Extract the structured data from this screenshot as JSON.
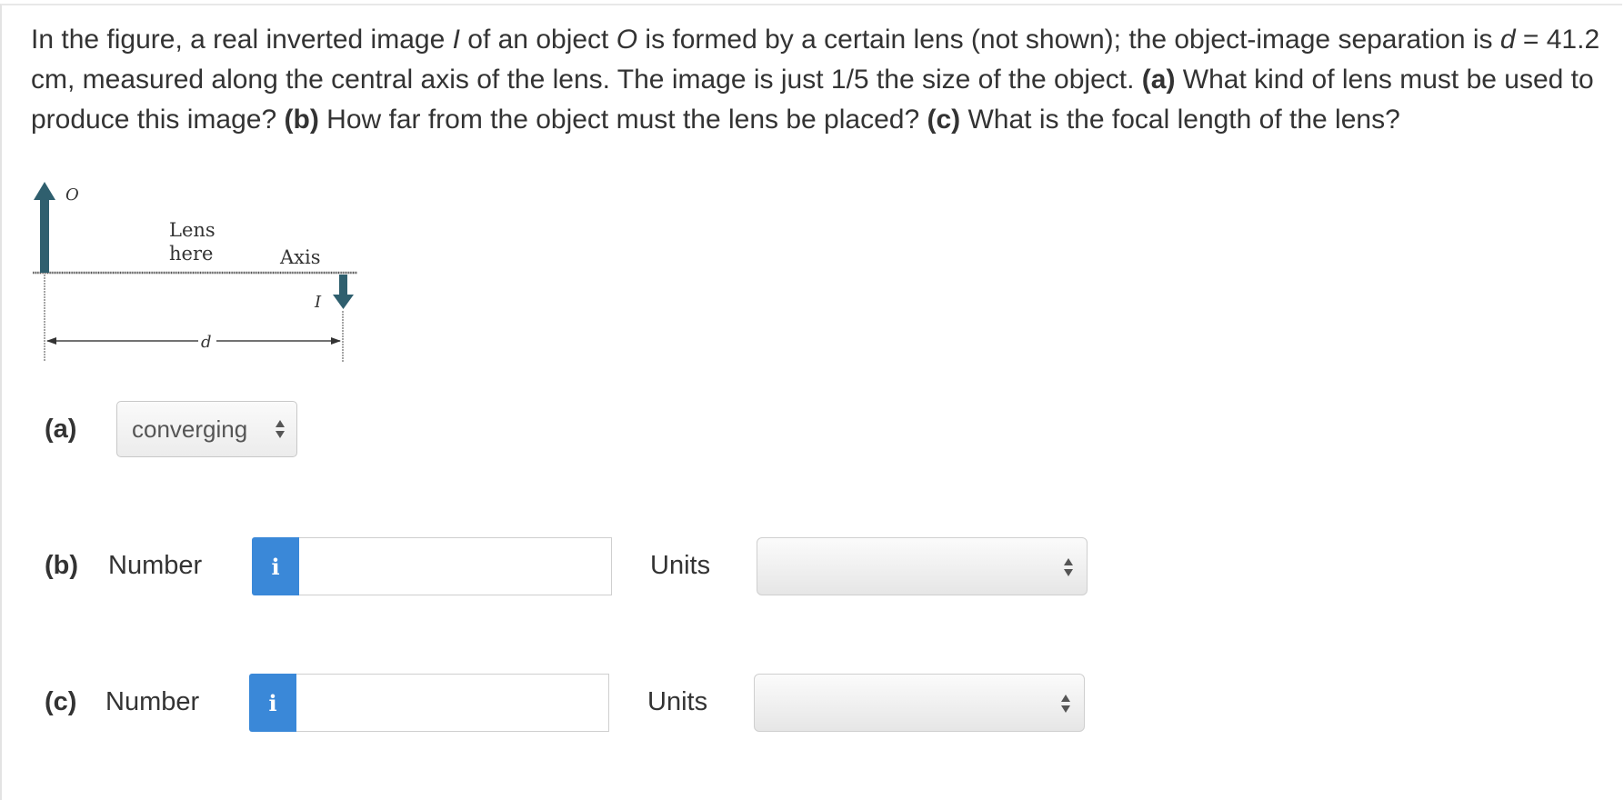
{
  "question": {
    "t1": "In the figure, a real inverted image ",
    "i_var": "I",
    "t2": " of an object ",
    "o_var": "O",
    "t3": " is formed by a certain lens (not shown); the object-image separation is ",
    "d_var": "d",
    "t4": " = 41.2 cm, measured along the central axis of the lens. The image is just 1/5 the size of the object. ",
    "a_tag": "(a)",
    "t5": " What kind of lens must be used to produce this image? ",
    "b_tag": "(b)",
    "t6": " How far from the object must the lens be placed? ",
    "c_tag": "(c)",
    "t7": " What is the focal length of the lens?"
  },
  "figure": {
    "object_label": "O",
    "lens_label_line1": "Lens",
    "lens_label_line2": "here",
    "axis_label": "Axis",
    "image_label": "I",
    "distance_label": "d"
  },
  "part_a": {
    "label": "(a)",
    "selected": "converging"
  },
  "part_b": {
    "label": "(b)",
    "number_label": "Number",
    "info_icon": "i",
    "value": "",
    "units_label": "Units",
    "units_selected": ""
  },
  "part_c": {
    "label": "(c)",
    "number_label": "Number",
    "info_icon": "i",
    "value": "",
    "units_label": "Units",
    "units_selected": ""
  },
  "colors": {
    "info_button": "#3a88d8",
    "arrow": "#2f5f6e"
  }
}
